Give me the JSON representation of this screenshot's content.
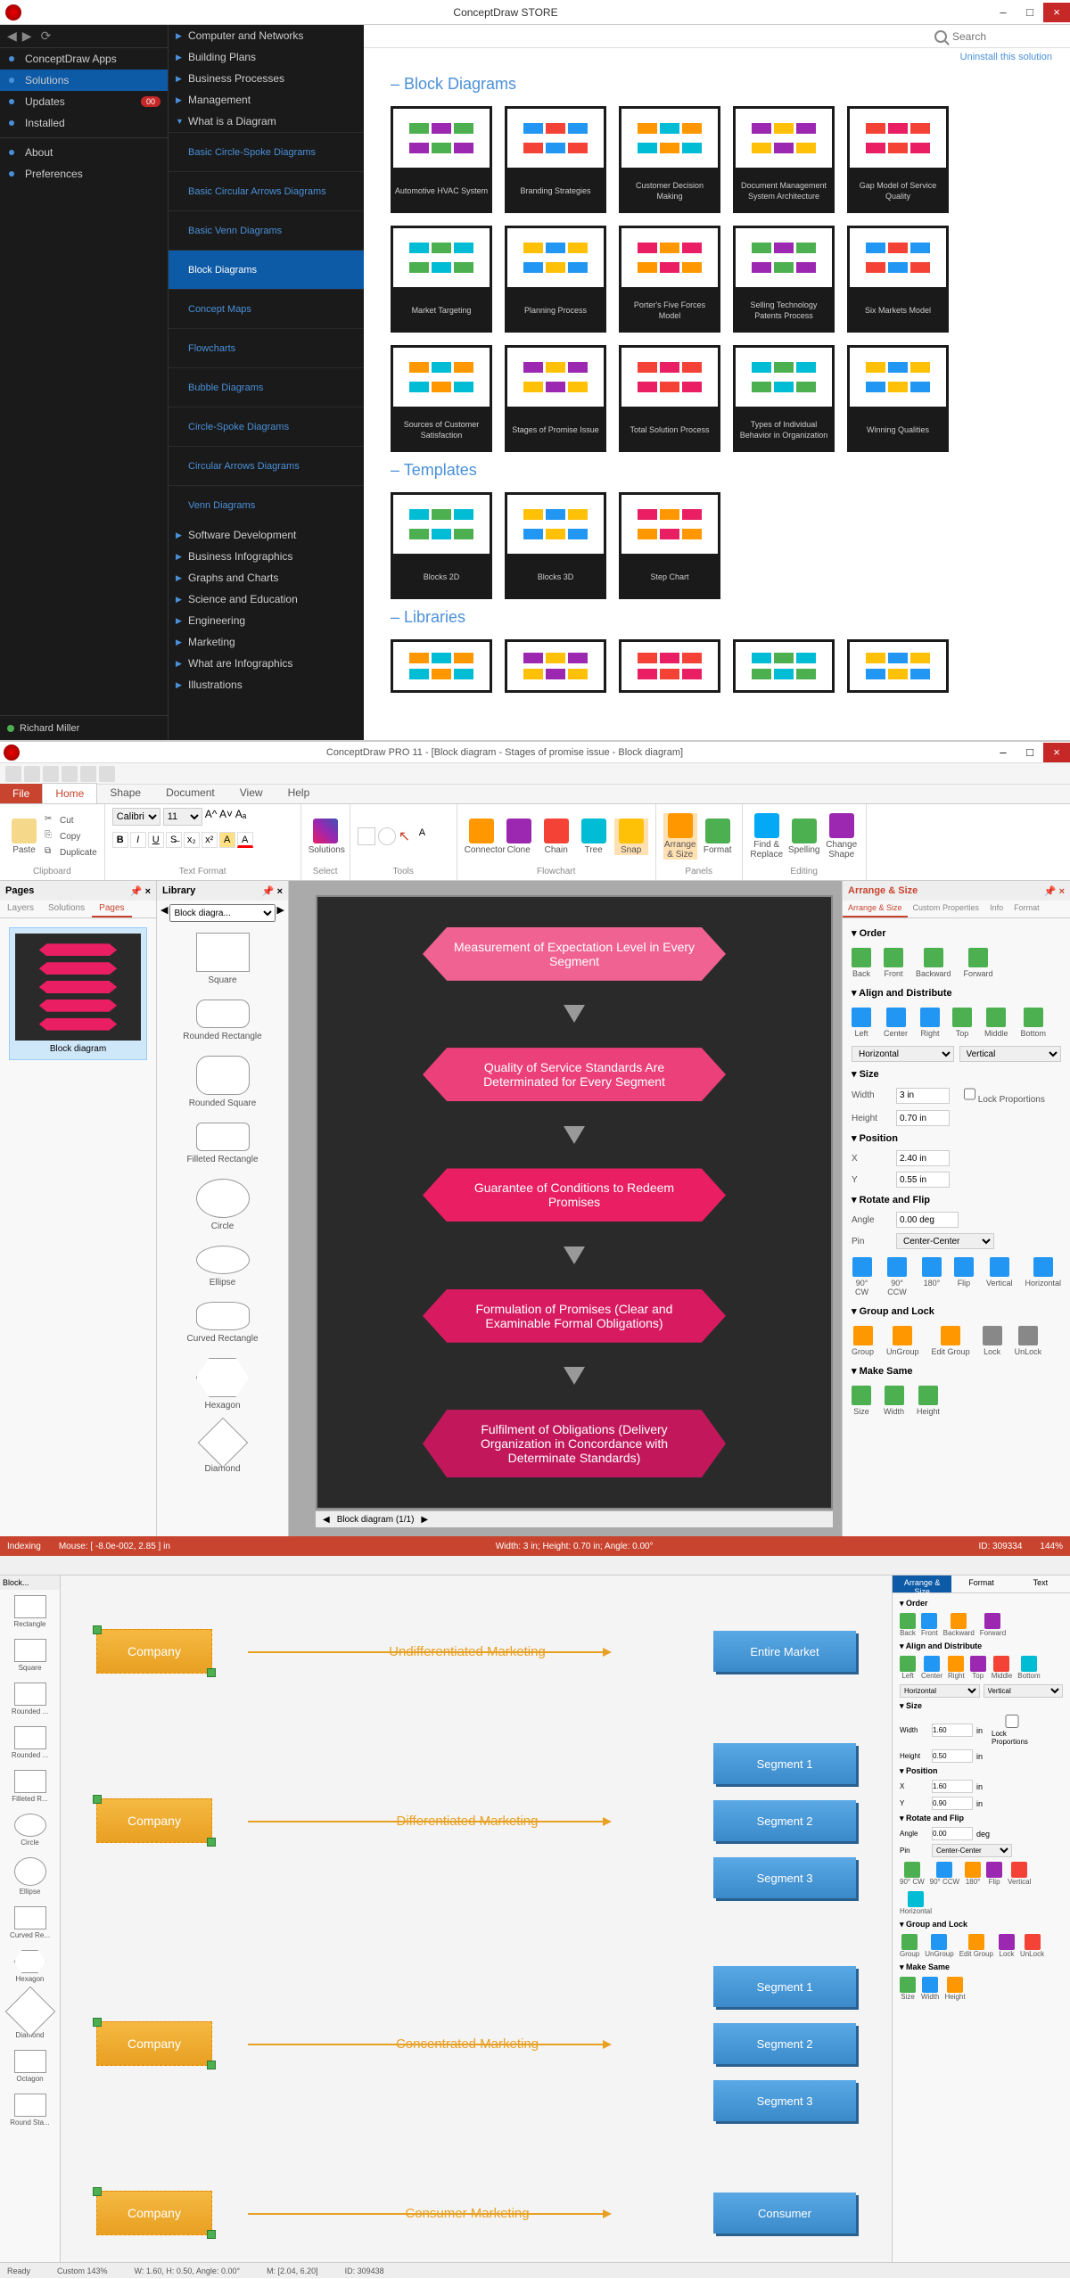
{
  "win1": {
    "title": "ConceptDraw STORE",
    "search_placeholder": "Search",
    "uninstall": "Uninstall this solution",
    "nav_left": [
      {
        "label": "ConceptDraw Apps"
      },
      {
        "label": "Solutions",
        "selected": true
      },
      {
        "label": "Updates",
        "badge": "00"
      },
      {
        "label": "Installed"
      }
    ],
    "nav_left2": [
      {
        "label": "About"
      },
      {
        "label": "Preferences"
      }
    ],
    "user": "Richard Miller",
    "categories": [
      {
        "label": "Computer and Networks"
      },
      {
        "label": "Building Plans"
      },
      {
        "label": "Business Processes"
      },
      {
        "label": "Management"
      },
      {
        "label": "What is a Diagram",
        "expanded": true
      }
    ],
    "subcats": [
      "Basic Circle-Spoke Diagrams",
      "Basic Circular Arrows Diagrams",
      "Basic Venn Diagrams",
      "Block Diagrams",
      "Concept Maps",
      "Flowcharts",
      "Bubble Diagrams",
      "Circle-Spoke Diagrams",
      "Circular Arrows Diagrams",
      "Venn Diagrams"
    ],
    "subcat_selected": "Block Diagrams",
    "categories2": [
      "Software Development",
      "Business Infographics",
      "Graphs and Charts",
      "Science and Education",
      "Engineering",
      "Marketing",
      "What are Infographics",
      "Illustrations"
    ],
    "sect_block": "Block Diagrams",
    "sect_templates": "Templates",
    "sect_libraries": "Libraries",
    "cards": [
      "Automotive HVAC System",
      "Branding Strategies",
      "Customer Decision Making",
      "Document Management System Architecture",
      "Gap Model of Service Quality",
      "Market Targeting",
      "Planning Process",
      "Porter's Five Forces Model",
      "Selling Technology Patents Process",
      "Six Markets Model",
      "Sources of Customer Satisfaction",
      "Stages of Promise Issue",
      "Total Solution Process",
      "Types of Individual Behavior in Organization",
      "Winning Qualities"
    ],
    "templates": [
      "Blocks 2D",
      "Blocks 3D",
      "Step Chart"
    ]
  },
  "win2": {
    "title": "ConceptDraw PRO 11 - [Block diagram - Stages of promise issue - Block diagram]",
    "file_tab": "File",
    "tabs": [
      "Home",
      "Shape",
      "Document",
      "View",
      "Help"
    ],
    "tab_selected": "Home",
    "ribbon": {
      "clipboard": {
        "paste": "Paste",
        "cut": "Cut",
        "copy": "Copy",
        "dup": "Duplicate",
        "label": "Clipboard"
      },
      "textfmt": {
        "font": "Calibri",
        "size": "11",
        "label": "Text Format"
      },
      "solutions": {
        "btn": "Solutions",
        "label": "Select"
      },
      "tools_label": "Tools",
      "flowchart": {
        "connector": "Connector",
        "clone": "Clone",
        "chain": "Chain",
        "tree": "Tree",
        "snap": "Snap",
        "label": "Flowchart"
      },
      "panels": {
        "arrange": "Arrange & Size",
        "format": "Format",
        "label": "Panels"
      },
      "editing": {
        "find": "Find & Replace",
        "spell": "Spelling",
        "change": "Change Shape",
        "label": "Editing"
      }
    },
    "pages": {
      "title": "Pages",
      "tabs": [
        "Layers",
        "Solutions",
        "Pages"
      ],
      "sel": "Pages",
      "thumb_label": "Block diagram"
    },
    "library": {
      "title": "Library",
      "select": "Block diagra...",
      "shapes": [
        "Square",
        "Rounded Rectangle",
        "Rounded Square",
        "Filleted Rectangle",
        "Circle",
        "Ellipse",
        "Curved Rectangle",
        "Hexagon",
        "Diamond"
      ]
    },
    "canvas": {
      "nodes": [
        {
          "text": "Measurement of Expectation Level in Every Segment",
          "color": "#f06292"
        },
        {
          "text": "Quality of Service Standards Are Determinated for Every Segment",
          "color": "#ec407a"
        },
        {
          "text": "Guarantee of Conditions to Redeem Promises",
          "color": "#e91e63"
        },
        {
          "text": "Formulation of Promises (Clear and Examinable Formal Obligations)",
          "color": "#d81b60"
        },
        {
          "text": "Fulfilment of Obligations (Delivery Organization in Concordance with Determinate Standards)",
          "color": "#c2185b"
        }
      ],
      "tab": "Block diagram (1/1)"
    },
    "props": {
      "title": "Arrange & Size",
      "tabs": [
        "Arrange & Size",
        "Custom Properties",
        "Info",
        "Format"
      ],
      "sel": "Arrange & Size",
      "order": {
        "title": "Order",
        "btns": [
          "Back",
          "Front",
          "Backward",
          "Forward"
        ]
      },
      "align": {
        "title": "Align and Distribute",
        "btns": [
          "Left",
          "Center",
          "Right",
          "Top",
          "Middle",
          "Bottom"
        ],
        "h": "Horizontal",
        "v": "Vertical"
      },
      "size": {
        "title": "Size",
        "width_label": "Width",
        "height_label": "Height",
        "width": "3 in",
        "height": "0.70 in",
        "lock": "Lock Proportions"
      },
      "pos": {
        "title": "Position",
        "x_label": "X",
        "y_label": "Y",
        "x": "2.40 in",
        "y": "0.55 in"
      },
      "rotate": {
        "title": "Rotate and Flip",
        "angle_label": "Angle",
        "angle": "0.00 deg",
        "pin_label": "Pin",
        "pin": "Center-Center",
        "btns": [
          "90° CW",
          "90° CCW",
          "180°",
          "Flip",
          "Vertical",
          "Horizontal"
        ]
      },
      "group": {
        "title": "Group and Lock",
        "btns": [
          "Group",
          "UnGroup",
          "Edit Group",
          "Lock",
          "UnLock"
        ]
      },
      "make": {
        "title": "Make Same",
        "btns": [
          "Size",
          "Width",
          "Height"
        ]
      }
    },
    "status": {
      "indexing": "Indexing",
      "mouse": "Mouse: [ -8.0e-002, 2.85 ] in",
      "dims": "Width: 3 in;  Height: 0.70 in;  Angle: 0.00°",
      "id": "ID: 309334",
      "zoom": "144%"
    }
  },
  "win3": {
    "lib_title": "Block...",
    "shapes": [
      "Rectangle",
      "Square",
      "Rounded ...",
      "Rounded ...",
      "Filleted R...",
      "Circle",
      "Ellipse",
      "Curved Re...",
      "Hexagon",
      "Diamond",
      "Octagon",
      "Round Sta..."
    ],
    "rows": [
      {
        "company": "Company",
        "label": "Undifferentiated Marketing",
        "targets": [
          "Entire Market"
        ]
      },
      {
        "company": "Company",
        "label": "Differentiated Marketing",
        "targets": [
          "Segment 1",
          "Segment 2",
          "Segment 3"
        ]
      },
      {
        "company": "Company",
        "label": "Concentrated Marketing",
        "targets": [
          "Segment 1",
          "Segment 2",
          "Segment 3"
        ]
      },
      {
        "company": "Company",
        "label": "Consumer Marketing",
        "targets": [
          "Consumer"
        ]
      }
    ],
    "props": {
      "tabs": [
        "Arrange & Size",
        "Format",
        "Text"
      ],
      "sel": "Arrange & Size",
      "order": {
        "title": "Order",
        "btns": [
          "Back",
          "Front",
          "Backward",
          "Forward"
        ]
      },
      "align": {
        "title": "Align and Distribute",
        "btns": [
          "Left",
          "Center",
          "Right",
          "Top",
          "Middle",
          "Bottom"
        ],
        "h": "Horizontal",
        "v": "Vertical"
      },
      "size": {
        "title": "Size",
        "w": "1.60",
        "h": "0.50",
        "wi": "in",
        "hi": "in",
        "lock": "Lock Proportions"
      },
      "pos": {
        "title": "Position",
        "x": "1.60",
        "y": "0.90",
        "xi": "in",
        "yi": "in"
      },
      "rotate": {
        "title": "Rotate and Flip",
        "angle": "0.00",
        "au": "deg",
        "pin": "Center-Center",
        "btns": [
          "90° CW",
          "90° CCW",
          "180°",
          "Flip",
          "Vertical",
          "Horizontal"
        ]
      },
      "group": {
        "title": "Group and Lock",
        "btns": [
          "Group",
          "UnGroup",
          "Edit Group",
          "Lock",
          "UnLock"
        ]
      },
      "make": {
        "title": "Make Same",
        "btns": [
          "Size",
          "Width",
          "Height"
        ]
      }
    },
    "status": {
      "ready": "Ready",
      "custom": "Custom 143%",
      "wh": "W: 1.60, H: 0.50,  Angle: 0.00°",
      "m": "M: [2.04, 6.20]",
      "id": "ID: 309438"
    }
  }
}
